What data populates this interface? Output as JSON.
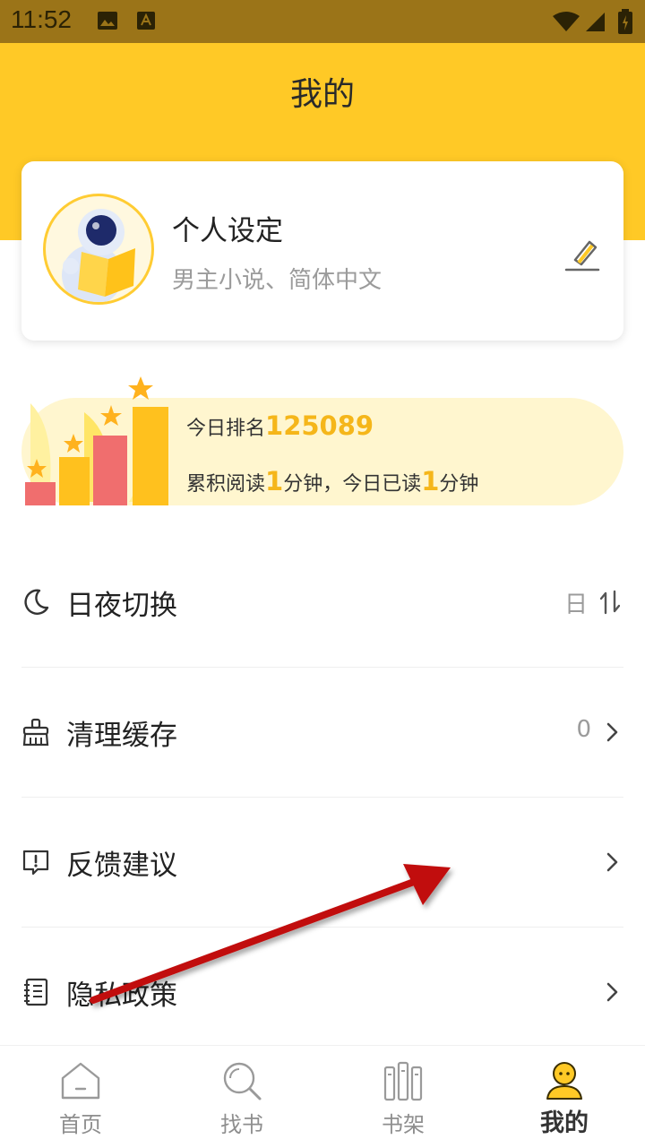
{
  "status_bar": {
    "time": "11:52"
  },
  "header": {
    "title": "我的"
  },
  "profile": {
    "name": "个人设定",
    "subtitle": "男主小说、简体中文"
  },
  "rank": {
    "label": "今日排名",
    "value": "125089",
    "total_prefix": "累积阅读",
    "total_minutes": "1",
    "total_unit": "分钟，今日已读",
    "today_minutes": "1",
    "today_unit": "分钟"
  },
  "menu": {
    "theme": {
      "label": "日夜切换",
      "value": "日"
    },
    "cache": {
      "label": "清理缓存",
      "value": "0"
    },
    "feedback": {
      "label": "反馈建议"
    },
    "privacy": {
      "label": "隐私政策"
    }
  },
  "tabs": [
    {
      "label": "首页",
      "icon": "home-icon"
    },
    {
      "label": "找书",
      "icon": "search-icon"
    },
    {
      "label": "书架",
      "icon": "bookshelf-icon"
    },
    {
      "label": "我的",
      "icon": "profile-icon",
      "active": true
    }
  ],
  "colors": {
    "accent": "#ffc926",
    "status_bar": "#9b7418",
    "highlight": "#f5b61a",
    "rank_bg": "#fff6cf"
  }
}
